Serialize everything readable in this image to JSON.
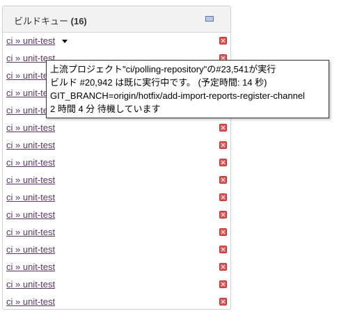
{
  "panel": {
    "title": "ビルドキュー",
    "count": "(16)"
  },
  "queue": [
    {
      "label": "ci » unit-test",
      "has_menu": true
    },
    {
      "label": "ci » unit-test"
    },
    {
      "label": "ci » unit-test"
    },
    {
      "label": "ci » unit-test"
    },
    {
      "label": "ci » unit-test"
    },
    {
      "label": "ci » unit-test"
    },
    {
      "label": "ci » unit-test"
    },
    {
      "label": "ci » unit-test"
    },
    {
      "label": "ci » unit-test"
    },
    {
      "label": "ci » unit-test"
    },
    {
      "label": "ci » unit-test"
    },
    {
      "label": "ci » unit-test"
    },
    {
      "label": "ci » unit-test"
    },
    {
      "label": "ci » unit-test"
    },
    {
      "label": "ci » unit-test"
    },
    {
      "label": "ci » unit-test"
    }
  ],
  "tooltip": {
    "line1": "上流プロジェクト\"ci/polling-repository\"の#23,541が実行",
    "line2": "ビルド #20,942 は既に実行中です。 (予定時間: 14 秒)",
    "line3": "GIT_BRANCH=origin/hotfix/add-import-reports-register-channel",
    "line4": "2 時間 4 分 待機しています"
  },
  "colors": {
    "link": "#5c3566",
    "cancel_icon": "#e55454",
    "header_bg": "#f2f2f2"
  }
}
